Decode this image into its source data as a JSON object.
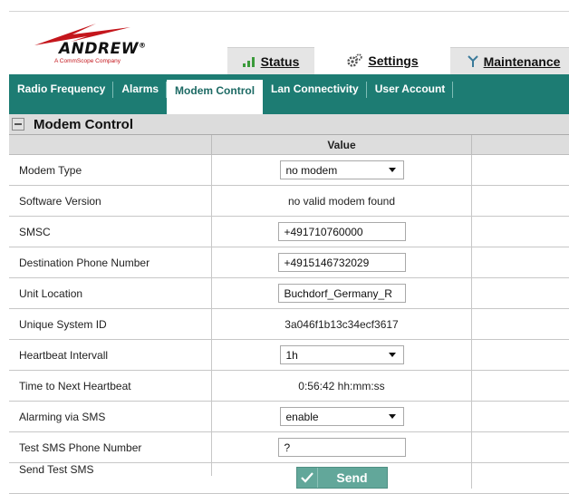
{
  "brand": {
    "name": "ANDREW",
    "tagline": "A CommScope Company",
    "color": "#c4161c"
  },
  "top_tabs": [
    {
      "label": "Status",
      "icon": "signal-bars-icon"
    },
    {
      "label": "Settings",
      "icon": "gears-icon"
    },
    {
      "label": "Maintenance",
      "icon": "antenna-icon"
    }
  ],
  "active_top_tab": "Settings",
  "nav": {
    "items": [
      "Radio Frequency",
      "Alarms",
      "Modem Control",
      "Lan Connectivity",
      "User Account"
    ],
    "active": "Modem Control",
    "color": "#1d7c73"
  },
  "section": {
    "title": "Modem Control",
    "collapse_icon": "minus-icon"
  },
  "table": {
    "value_header": "Value",
    "rows": [
      {
        "label": "Modem Type",
        "kind": "select",
        "value": "no modem"
      },
      {
        "label": "Software Version",
        "kind": "text",
        "value": "no valid modem found"
      },
      {
        "label": "SMSC",
        "kind": "input",
        "value": "+491710760000"
      },
      {
        "label": "Destination Phone Number",
        "kind": "input",
        "value": "+4915146732029"
      },
      {
        "label": "Unit Location",
        "kind": "input",
        "value": "Buchdorf_Germany_R"
      },
      {
        "label": "Unique System ID",
        "kind": "text",
        "value": "3a046f1b13c34ecf3617"
      },
      {
        "label": "Heartbeat Intervall",
        "kind": "select",
        "value": "1h"
      },
      {
        "label": "Time to Next Heartbeat",
        "kind": "text",
        "value": "0:56:42 hh:mm:ss"
      },
      {
        "label": "Alarming via SMS",
        "kind": "select",
        "value": "enable"
      },
      {
        "label": "Test SMS Phone Number",
        "kind": "input",
        "value": "?"
      },
      {
        "label": "Send Test SMS",
        "kind": "button",
        "value": "Send"
      }
    ]
  }
}
